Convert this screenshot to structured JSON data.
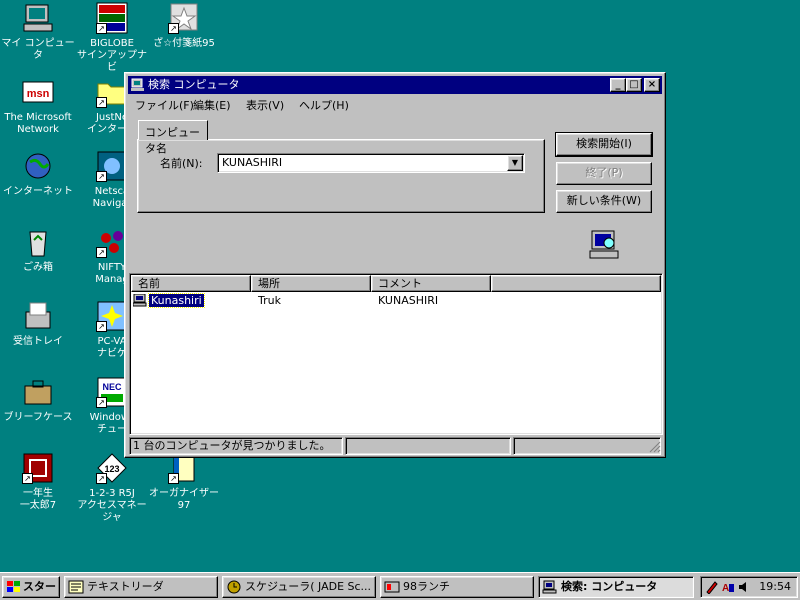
{
  "desktop_icons": [
    {
      "name": "my-computer-icon",
      "label": "マイ コンピュータ"
    },
    {
      "name": "biglobe-signup-icon",
      "label": "BIGLOBE\nサインアップナビ"
    },
    {
      "name": "sticky-notes-icon",
      "label": "ざ☆付箋紙95"
    },
    {
      "name": "msn-icon",
      "label": "The Microsoft\nNetwork"
    },
    {
      "name": "justnet-icon",
      "label": "JustNe\nインターネ"
    },
    {
      "name": "internet-icon",
      "label": "インターネット"
    },
    {
      "name": "netscape-icon",
      "label": "Netsca\nNavigat"
    },
    {
      "name": "recycle-bin-icon",
      "label": "ごみ箱"
    },
    {
      "name": "nifty-icon",
      "label": "NIFTY\nManag"
    },
    {
      "name": "inbox-icon",
      "label": "受信トレイ"
    },
    {
      "name": "pc-va-navi-icon",
      "label": "PC-VA\nナビゲ"
    },
    {
      "name": "briefcase-icon",
      "label": "ブリーフケース"
    },
    {
      "name": "windows-tutorial-icon",
      "label": "Windows\nチュー"
    },
    {
      "name": "ichitaro-icon",
      "label": "一年生\n一太郎7"
    },
    {
      "name": "lotus-123-icon",
      "label": "1-2-3 R5J\nアクセスマネージャ"
    },
    {
      "name": "organizer-icon",
      "label": "オーガナイザー\n97"
    }
  ],
  "window": {
    "title": "検索 コンピュータ",
    "buttons": {
      "minimize": "_",
      "maximize": "□",
      "close": "×"
    },
    "menu": [
      "ファイル(F)",
      "編集(E)",
      "表示(V)",
      "ヘルプ(H)"
    ],
    "tab_label": "コンピュータ名",
    "name_label": "名前(N):",
    "name_value": "KUNASHIRI",
    "search_button": "検索開始(I)",
    "stop_button": "終了(P)",
    "new_search_button": "新しい条件(W)",
    "columns": [
      "名前",
      "場所",
      "コメント"
    ],
    "results": [
      {
        "name": "Kunashiri",
        "location": "Truk",
        "comment": "KUNASHIRI"
      }
    ],
    "status": "1 台のコンピュータが見つかりました。"
  },
  "taskbar": {
    "start": "スタート",
    "items": [
      {
        "label": "テキストリーダ",
        "active": false
      },
      {
        "label": "スケジューラ( JADE Sc...",
        "active": false
      },
      {
        "label": "98ランチ",
        "active": false
      },
      {
        "label": "検索: コンピュータ",
        "active": true
      }
    ],
    "clock": "19:54"
  },
  "colors": {
    "desktop": "#008080",
    "titlebar": "#000080",
    "face": "#c0c0c0",
    "selection": "#000080"
  }
}
